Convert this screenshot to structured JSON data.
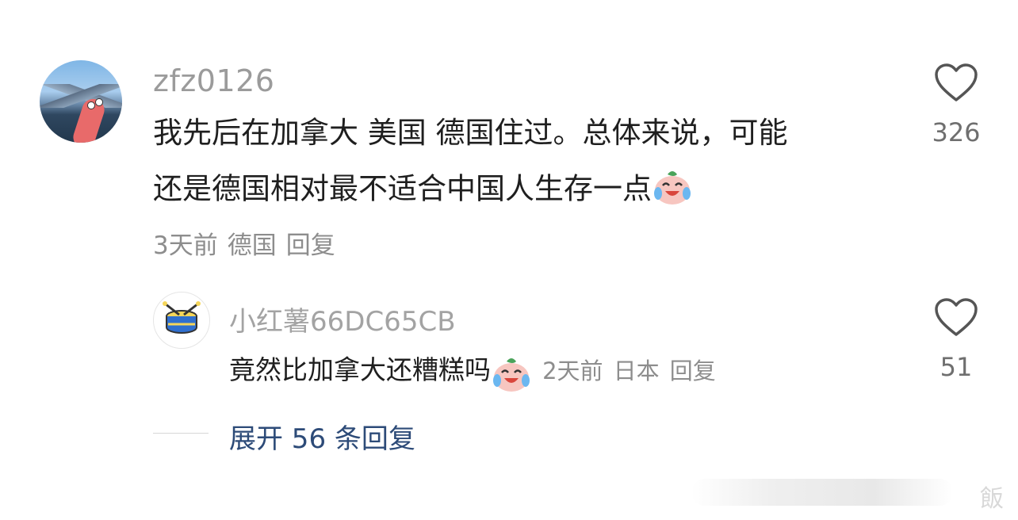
{
  "comment": {
    "username": "zfz0126",
    "line1": "我先后在加拿大 美国 德国住过。总体来说，可能",
    "line2": "还是德国相对最不适合中国人生存一点",
    "emoji": "laugh-cry-emoji",
    "time": "3天前",
    "location": "德国",
    "reply_label": "回复",
    "likes": "326"
  },
  "reply": {
    "username": "小红薯66DC65CB",
    "text": "竟然比加拿大还糟糕吗",
    "emoji": "laugh-cry-emoji",
    "time": "2天前",
    "location": "日本",
    "reply_label": "回复",
    "likes": "51"
  },
  "expand_replies": "展开 56 条回复",
  "watermark": "飯"
}
